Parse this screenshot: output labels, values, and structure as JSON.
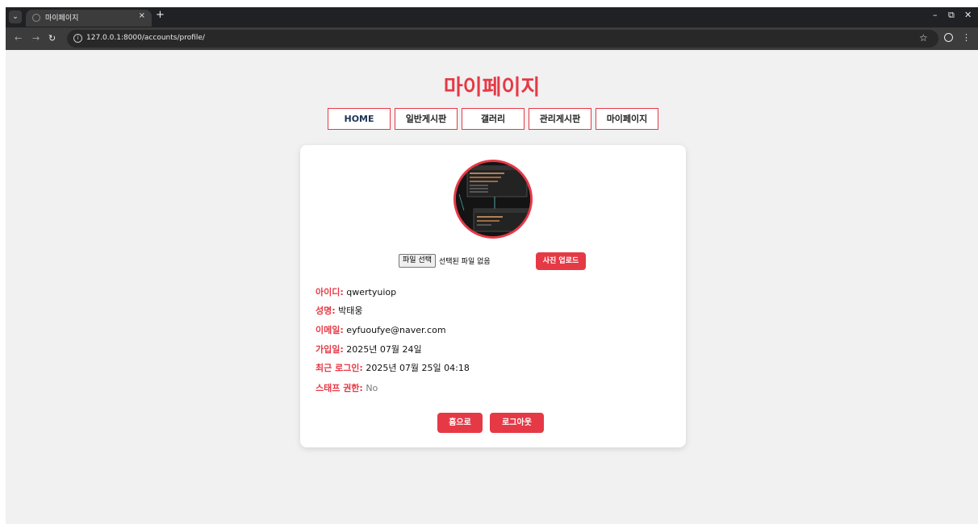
{
  "browser": {
    "tab_title": "마이페이지",
    "tab_close": "×",
    "new_tab": "+",
    "url": "127.0.0.1:8000/accounts/profile/",
    "icons": [
      "tab-list-icon",
      "back-icon",
      "forward-icon",
      "reload-icon",
      "site-info-icon",
      "bookmark-star-icon",
      "profile-icon",
      "kebab-menu-icon",
      "minimize-icon",
      "restore-icon",
      "close-icon"
    ]
  },
  "page": {
    "title": "마이페이지",
    "accent_color": "#e63946",
    "nav": [
      "HOME",
      "일반게시판",
      "갤러리",
      "관리게시판",
      "마이페이지"
    ]
  },
  "profile": {
    "file_button": "파일 선택",
    "file_status": "선택된 파일 없음",
    "upload_button": "사진 업로드",
    "fields": [
      {
        "label": "아이디:",
        "value": "qwertyuiop"
      },
      {
        "label": "성명:",
        "value": "박태웅"
      },
      {
        "label": "이메일:",
        "value": "eyfuoufye@naver.com"
      },
      {
        "label": "가입일:",
        "value": "2025년 07월 24일"
      },
      {
        "label": "최근 로그인:",
        "value": "2025년 07월 25일 04:18"
      },
      {
        "label": "스태프 권한:",
        "value": "No"
      }
    ],
    "home_button": "홈으로",
    "logout_button": "로그아웃"
  }
}
